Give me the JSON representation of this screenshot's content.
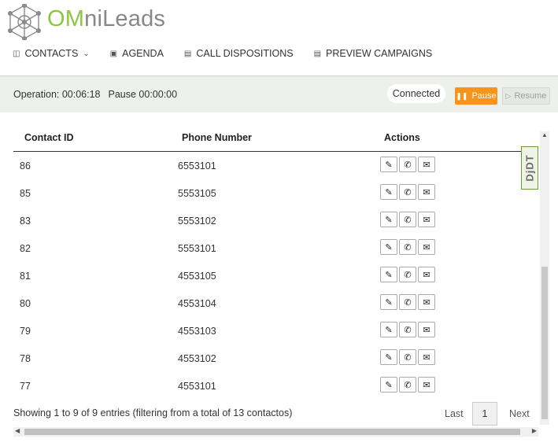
{
  "brand": {
    "om": "OM",
    "rest": "niLeads"
  },
  "nav": [
    {
      "icon": "◫",
      "label": "CONTACTS",
      "dropdown": true
    },
    {
      "icon": "▣",
      "label": "AGENDA"
    },
    {
      "icon": "▤",
      "label": "CALL DISPOSITIONS"
    },
    {
      "icon": "▤",
      "label": "PREVIEW CAMPAIGNS"
    }
  ],
  "status": {
    "operation": "Operation: 00:06:18",
    "pause_time": "Pause 00:00:00",
    "connected": "Connected",
    "pause_label": "Pause",
    "resume_label": "Resume"
  },
  "table": {
    "headers": [
      "Contact ID",
      "Phone Number",
      "Actions"
    ],
    "rows": [
      [
        "86",
        "6553101"
      ],
      [
        "85",
        "5553105"
      ],
      [
        "83",
        "5553102"
      ],
      [
        "82",
        "5553101"
      ],
      [
        "81",
        "4553105"
      ],
      [
        "80",
        "4553104"
      ],
      [
        "79",
        "4553103"
      ],
      [
        "78",
        "4553102"
      ],
      [
        "77",
        "4553101"
      ]
    ]
  },
  "djdt": "DjDT",
  "footer": {
    "info": "Showing 1 to 9 of 9 entries (filtering from a total of 13 contactos)",
    "last": "Last",
    "page": "1",
    "next": "Next"
  },
  "colors": {
    "accent": "#8cc63f",
    "pause": "#f7941d"
  }
}
